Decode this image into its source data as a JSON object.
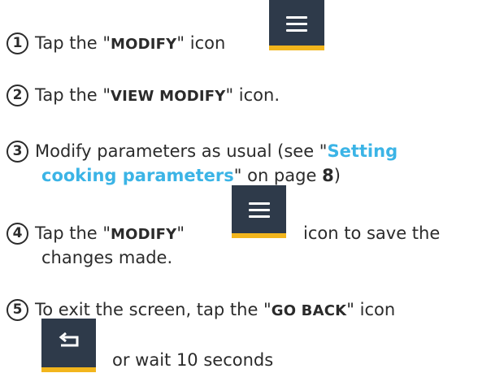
{
  "step1": {
    "number": "1",
    "prefix": "Tap the \"",
    "keyword": "MODIFY",
    "suffix": "\" icon",
    "icon": "menu-icon"
  },
  "step2": {
    "number": "2",
    "prefix": "Tap the \"",
    "keyword": "VIEW MODIFY",
    "suffix": "\" icon."
  },
  "step3": {
    "number": "3",
    "line1_prefix": "Modify parameters as usual (see \"",
    "link_part1": "Setting",
    "link_part2": "cooking parameters",
    "line2_suffix": "\" on page ",
    "page": "8",
    "close": ")"
  },
  "step4": {
    "number": "4",
    "prefix": "Tap the \"",
    "keyword": "MODIFY",
    "suffix": "\"",
    "after_icon": "icon to save the",
    "line2": "changes made.",
    "icon": "menu-icon"
  },
  "step5": {
    "number": "5",
    "prefix": "To exit the screen, tap the \"",
    "keyword": "GO BACK",
    "suffix": "\" icon",
    "line2": "or wait 10 seconds",
    "icon": "go-back-icon"
  },
  "colors": {
    "text": "#2b2b2b",
    "link": "#3bb4e6",
    "button_bg": "#2e3a4a",
    "button_accent": "#f2b51c"
  }
}
